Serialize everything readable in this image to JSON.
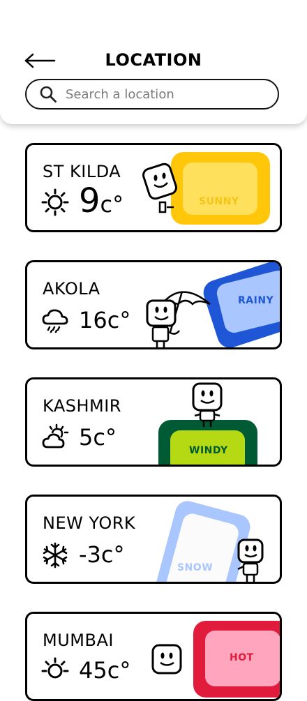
{
  "header": {
    "title": "LOCATION",
    "search_placeholder": "Search a location"
  },
  "locations": [
    {
      "city": "ST KILDA",
      "temp": "9",
      "unit": "c°",
      "condition": "SUNNY",
      "icon": "sun-icon",
      "color": "#FFC60A",
      "inner_color": "#FFE05C",
      "text_color": "#F4C419"
    },
    {
      "city": "AKOLA",
      "temp": "16c°",
      "condition": "RAINY",
      "icon": "rain-cloud-icon",
      "color": "#1E56D6",
      "inner_color": "#A9C6FF",
      "text_color": "#1E56D6"
    },
    {
      "city": "KASHMIR",
      "temp": "5c°",
      "condition": "WINDY",
      "icon": "partly-cloudy-icon",
      "color": "#005A34",
      "inner_color": "#B5DA14",
      "text_color": "#005A34"
    },
    {
      "city": "NEW YORK",
      "temp": "-3c°",
      "condition": "SNOW",
      "icon": "snowflake-icon",
      "color": "#A9C6FF",
      "inner_color": "#FBFBFB",
      "text_color": "#A9C6FF"
    },
    {
      "city": "MUMBAI",
      "temp": "45c°",
      "condition": "HOT",
      "icon": "sun-icon",
      "color": "#E11B3C",
      "inner_color": "#FFA6BE",
      "text_color": "#E11B3C"
    }
  ]
}
